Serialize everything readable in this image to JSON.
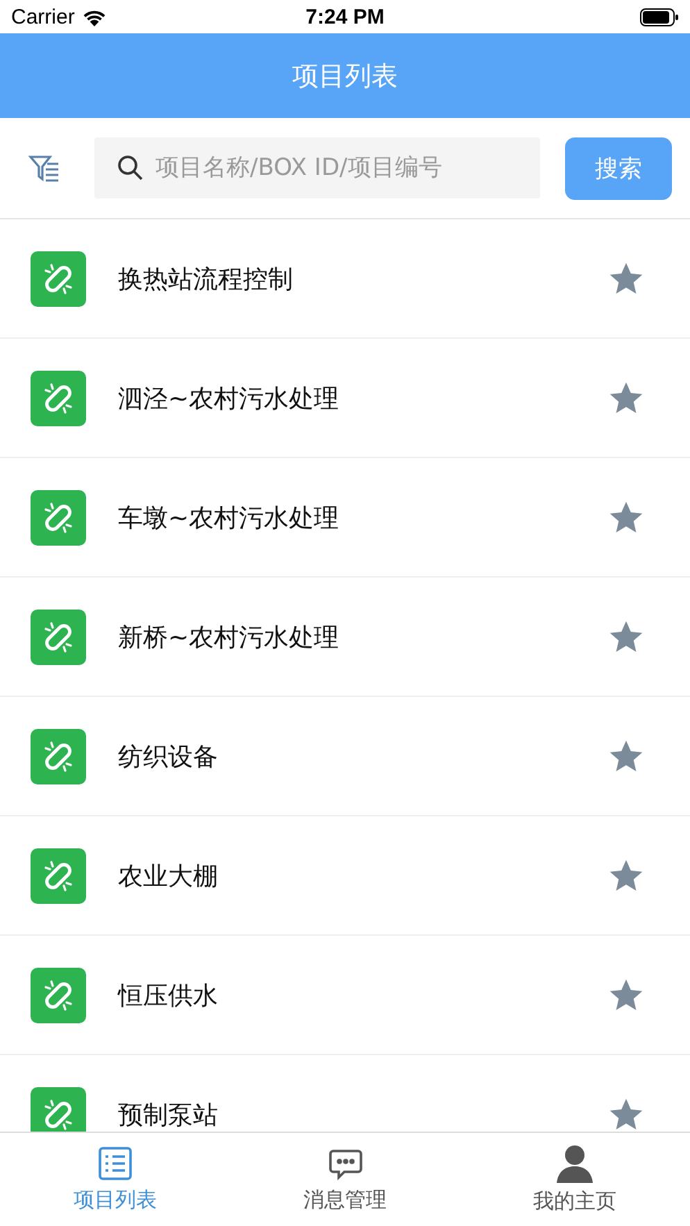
{
  "status_bar": {
    "carrier": "Carrier",
    "time": "7:24 PM"
  },
  "header": {
    "title": "项目列表"
  },
  "search": {
    "placeholder": "项目名称/BOX ID/项目编号",
    "button": "搜索"
  },
  "projects": [
    {
      "name": "换热站流程控制"
    },
    {
      "name": "泗泾~农村污水处理"
    },
    {
      "name": "车墩~农村污水处理"
    },
    {
      "name": "新桥~农村污水处理"
    },
    {
      "name": "纺织设备"
    },
    {
      "name": "农业大棚"
    },
    {
      "name": "恒压供水"
    },
    {
      "name": "预制泵站"
    }
  ],
  "tabs": [
    {
      "label": "项目列表",
      "kind": "list",
      "selected": true
    },
    {
      "label": "消息管理",
      "kind": "message",
      "selected": false
    },
    {
      "label": "我的主页",
      "kind": "profile",
      "selected": false
    }
  ]
}
